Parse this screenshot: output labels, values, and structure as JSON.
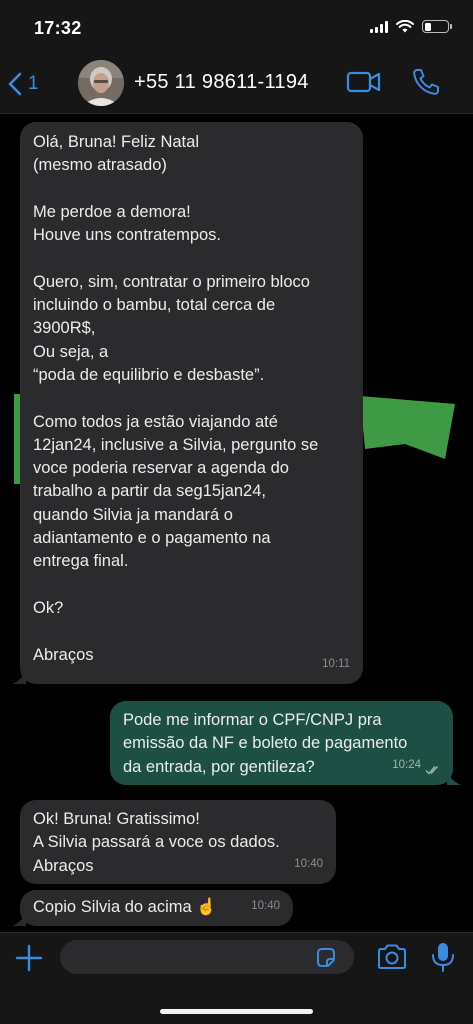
{
  "status_bar": {
    "time": "17:32",
    "battery_level": 0.3
  },
  "header": {
    "back_count": "1",
    "contact_name": "+55 11 98611-1194"
  },
  "messages": [
    {
      "direction": "incoming",
      "text": "Olá, Bruna! Feliz Natal\n(mesmo atrasado)\n\nMe perdoe a demora!\nHouve uns contratempos.\n\nQuero, sim, contratar o primeiro bloco\nincluindo o bambu, total cerca de\n3900R$,\nOu seja, a\n“poda de equilibrio e desbaste”.\n\nComo todos ja estão viajando até\n12jan24, inclusive a Silvia, pergunto se\nvoce poderia reservar a agenda do\ntrabalho a partir da seg15jan24,\nquando Silvia ja mandará o\nadiantamento e o pagamento na\nentrega final.\n\nOk?\n\nAbraços",
      "time": "10:11"
    },
    {
      "direction": "outgoing",
      "text": "Pode me informar o CPF/CNPJ pra\nemissão da NF e boleto de pagamento\nda entrada, por gentileza?",
      "time": "10:24",
      "status": "read"
    },
    {
      "direction": "incoming",
      "text": "Ok! Bruna! Gratissimo!\nA Silvia passará a voce os dados.\nAbraços",
      "time": "10:40"
    },
    {
      "direction": "incoming",
      "text": "Copio Silvia do acima ☝️",
      "time": "10:40"
    }
  ],
  "composer": {
    "placeholder": ""
  },
  "icons": {
    "back": "chevron-left-icon",
    "video": "video-camera-icon",
    "call": "phone-icon",
    "attach": "plus-icon",
    "sticker": "sticker-icon",
    "camera": "camera-icon",
    "mic": "microphone-icon"
  },
  "colors": {
    "accent": "#3a8ce0",
    "incoming_bubble": "#2b2b2d",
    "outgoing_bubble": "#1e4f45",
    "wallpaper_shape": "#3f9a45"
  }
}
